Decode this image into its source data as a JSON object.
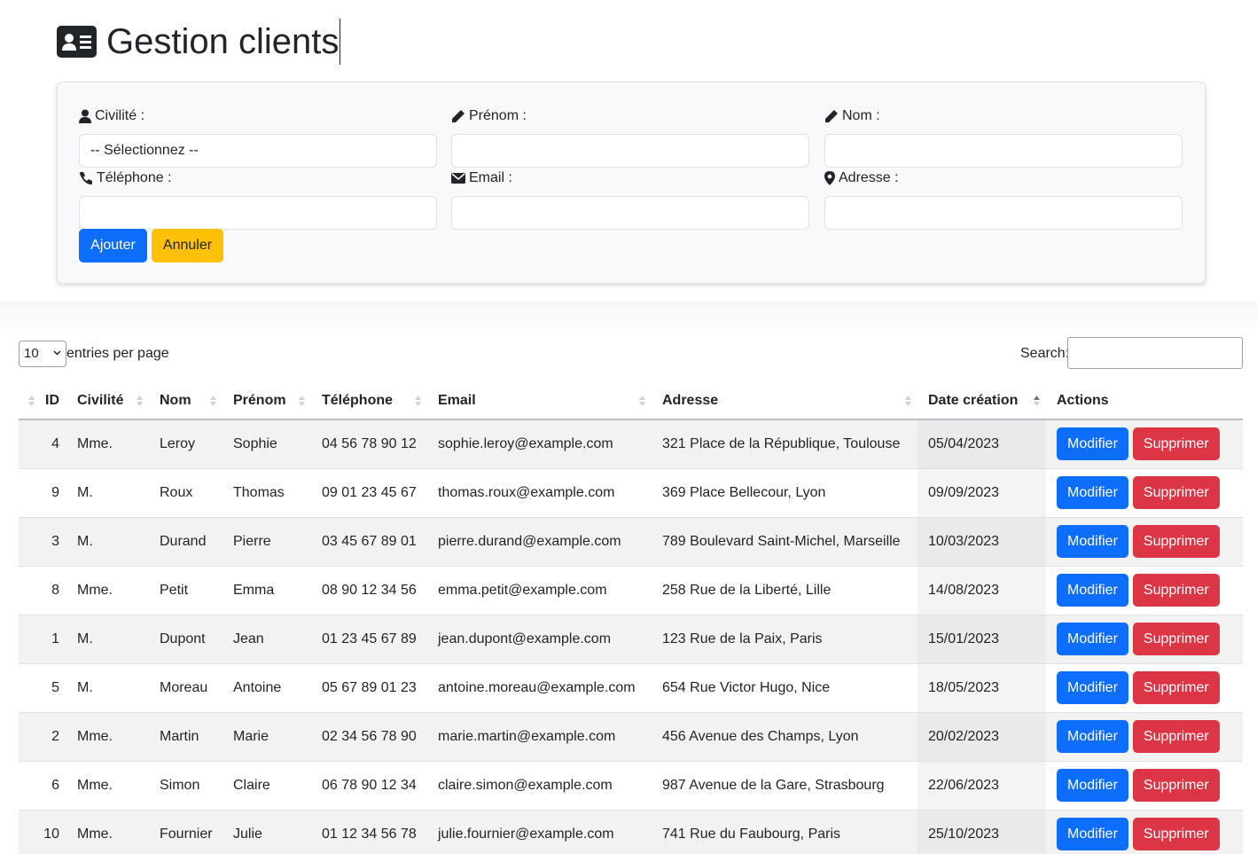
{
  "page": {
    "title": "Gestion clients",
    "title_icon": "id-card-icon"
  },
  "form": {
    "civilite": {
      "label": "Civilité :",
      "value": "-- Sélectionnez --",
      "icon": "user-icon"
    },
    "prenom": {
      "label": "Prénom :",
      "value": "",
      "icon": "pencil-icon"
    },
    "nom": {
      "label": "Nom :",
      "value": "",
      "icon": "pencil-icon"
    },
    "telephone": {
      "label": "Téléphone :",
      "value": "",
      "icon": "phone-icon"
    },
    "email": {
      "label": "Email :",
      "value": "",
      "icon": "envelope-icon"
    },
    "adresse": {
      "label": "Adresse :",
      "value": "",
      "icon": "map-marker-icon"
    },
    "add_label": "Ajouter",
    "cancel_label": "Annuler"
  },
  "table_controls": {
    "page_length": "10",
    "page_length_label": "entries per page",
    "search_label": "Search:",
    "search_value": ""
  },
  "table": {
    "columns": [
      "ID",
      "Civilité",
      "Nom",
      "Prénom",
      "Téléphone",
      "Email",
      "Adresse",
      "Date création",
      "Actions"
    ],
    "sorted_column": "Date création",
    "sort_direction": "ascending",
    "edit_label": "Modifier",
    "delete_label": "Supprimer",
    "rows": [
      {
        "id": "4",
        "civilite": "Mme.",
        "nom": "Leroy",
        "prenom": "Sophie",
        "telephone": "04 56 78 90 12",
        "email": "sophie.leroy@example.com",
        "adresse": "321 Place de la République, Toulouse",
        "date": "05/04/2023"
      },
      {
        "id": "9",
        "civilite": "M.",
        "nom": "Roux",
        "prenom": "Thomas",
        "telephone": "09 01 23 45 67",
        "email": "thomas.roux@example.com",
        "adresse": "369 Place Bellecour, Lyon",
        "date": "09/09/2023"
      },
      {
        "id": "3",
        "civilite": "M.",
        "nom": "Durand",
        "prenom": "Pierre",
        "telephone": "03 45 67 89 01",
        "email": "pierre.durand@example.com",
        "adresse": "789 Boulevard Saint-Michel, Marseille",
        "date": "10/03/2023"
      },
      {
        "id": "8",
        "civilite": "Mme.",
        "nom": "Petit",
        "prenom": "Emma",
        "telephone": "08 90 12 34 56",
        "email": "emma.petit@example.com",
        "adresse": "258 Rue de la Liberté, Lille",
        "date": "14/08/2023"
      },
      {
        "id": "1",
        "civilite": "M.",
        "nom": "Dupont",
        "prenom": "Jean",
        "telephone": "01 23 45 67 89",
        "email": "jean.dupont@example.com",
        "adresse": "123 Rue de la Paix, Paris",
        "date": "15/01/2023"
      },
      {
        "id": "5",
        "civilite": "M.",
        "nom": "Moreau",
        "prenom": "Antoine",
        "telephone": "05 67 89 01 23",
        "email": "antoine.moreau@example.com",
        "adresse": "654 Rue Victor Hugo, Nice",
        "date": "18/05/2023"
      },
      {
        "id": "2",
        "civilite": "Mme.",
        "nom": "Martin",
        "prenom": "Marie",
        "telephone": "02 34 56 78 90",
        "email": "marie.martin@example.com",
        "adresse": "456 Avenue des Champs, Lyon",
        "date": "20/02/2023"
      },
      {
        "id": "6",
        "civilite": "Mme.",
        "nom": "Simon",
        "prenom": "Claire",
        "telephone": "06 78 90 12 34",
        "email": "claire.simon@example.com",
        "adresse": "987 Avenue de la Gare, Strasbourg",
        "date": "22/06/2023"
      },
      {
        "id": "10",
        "civilite": "Mme.",
        "nom": "Fournier",
        "prenom": "Julie",
        "telephone": "01 12 34 56 78",
        "email": "julie.fournier@example.com",
        "adresse": "741 Rue du Faubourg, Paris",
        "date": "25/10/2023"
      }
    ]
  },
  "colors": {
    "primary": "#0d6efd",
    "warning": "#ffc107",
    "danger": "#dc3545"
  }
}
